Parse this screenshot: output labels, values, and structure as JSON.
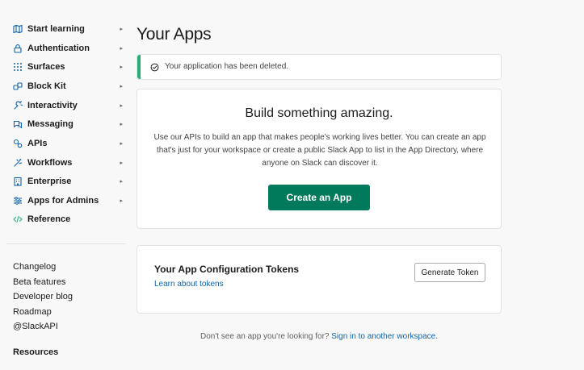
{
  "sidebar": {
    "items": [
      {
        "label": "Start learning",
        "icon": "map-icon",
        "caret": "▸"
      },
      {
        "label": "Authentication",
        "icon": "lock-icon",
        "caret": "▸"
      },
      {
        "label": "Surfaces",
        "icon": "grid-icon",
        "caret": "▸"
      },
      {
        "label": "Block Kit",
        "icon": "blocks-icon",
        "caret": "▸"
      },
      {
        "label": "Interactivity",
        "icon": "interactivity-icon",
        "caret": "▸"
      },
      {
        "label": "Messaging",
        "icon": "message-icon",
        "caret": "▸"
      },
      {
        "label": "APIs",
        "icon": "apis-icon",
        "caret": "▸"
      },
      {
        "label": "Workflows",
        "icon": "workflow-icon",
        "caret": "▸"
      },
      {
        "label": "Enterprise",
        "icon": "building-icon",
        "caret": "▸"
      },
      {
        "label": "Apps for Admins",
        "icon": "sliders-icon",
        "caret": "▸"
      },
      {
        "label": "Reference",
        "icon": "code-icon",
        "caret": ""
      }
    ],
    "links": [
      "Changelog",
      "Beta features",
      "Developer blog",
      "Roadmap",
      "@SlackAPI"
    ],
    "resources_heading": "Resources"
  },
  "main": {
    "title": "Your Apps",
    "alert": {
      "text": "Your application has been deleted.",
      "color": "#2bac76"
    },
    "build": {
      "title": "Build something amazing.",
      "description": "Use our APIs to build an app that makes people's working lives better. You can create an app that's just for your workspace or create a public Slack App to list in the App Directory, where anyone on Slack can discover it.",
      "button_label": "Create an App",
      "button_color": "#007a5a"
    },
    "tokens": {
      "title": "Your App Configuration Tokens",
      "link": "Learn about tokens",
      "button_label": "Generate Token"
    },
    "footer": {
      "text": "Don't see an app you're looking for?",
      "link": "Sign in to another workspace",
      "suffix": "."
    }
  }
}
